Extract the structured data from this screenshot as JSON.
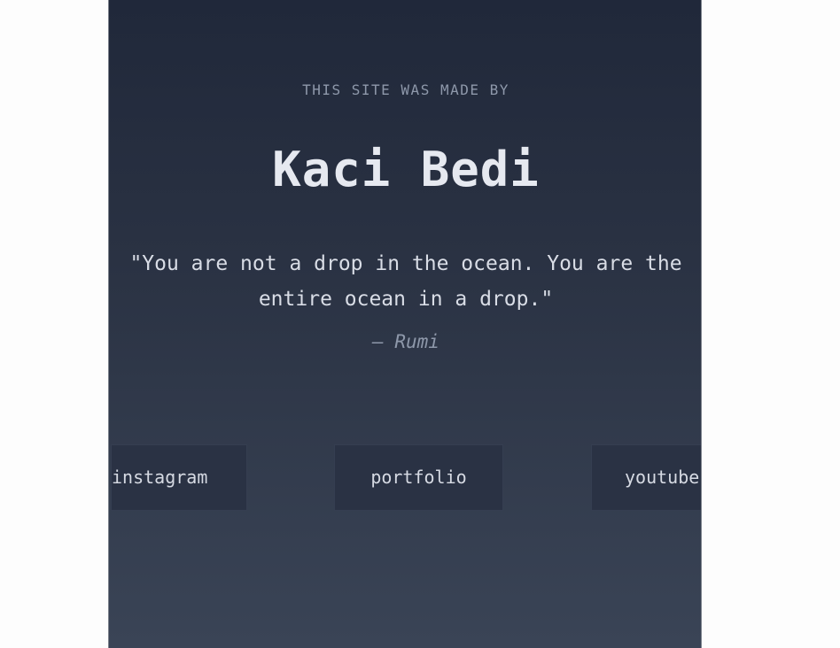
{
  "hero": {
    "eyebrow": "THIS SITE WAS MADE BY",
    "name": "Kaci Bedi",
    "quote_line1": "\"You are not a drop in the ocean. You are the",
    "quote_line2": "entire ocean in a drop.\"",
    "author": "— Rumi"
  },
  "links": {
    "instagram": "instagram",
    "portfolio": "portfolio",
    "youtube": "youtube"
  },
  "colors": {
    "panel_top": "#20283a",
    "panel_bottom": "#3a4456",
    "text_primary": "#e6e9f0",
    "text_muted": "#8e98aa",
    "button_bg": "#2a3244"
  }
}
